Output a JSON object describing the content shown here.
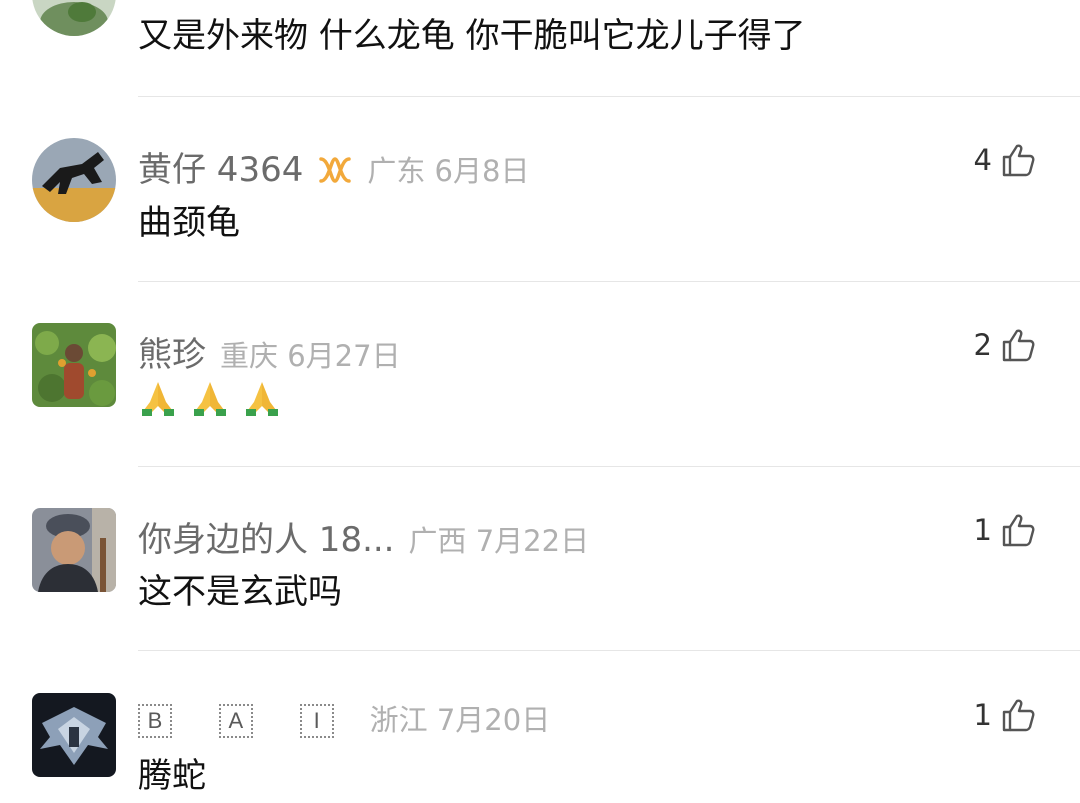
{
  "comments": [
    {
      "username": "",
      "location_date": "",
      "text": "又是外来物 什么龙龟 你干脆叫它龙儿子得了",
      "likes": ""
    },
    {
      "username": "黄仔 4364",
      "badge_icon": "gold-ring-badge-icon",
      "location_date": "广东 6月8日",
      "text": "曲颈龟",
      "likes": "4"
    },
    {
      "username": "熊珍",
      "location_date": "重庆 6月27日",
      "text": "",
      "emoji": [
        "folded-hands-emoji",
        "folded-hands-emoji",
        "folded-hands-emoji"
      ],
      "likes": "2"
    },
    {
      "username": "你身边的人 18...",
      "location_date": "广西 7月22日",
      "text": "这不是玄武吗",
      "likes": "1"
    },
    {
      "username_chars": [
        "B",
        "A",
        "I"
      ],
      "location_date": "浙江 7月20日",
      "text": "腾蛇",
      "likes": "1"
    }
  ],
  "colors": {
    "username": "#6b6b6b",
    "meta": "#b0b0b0",
    "text": "#111111",
    "divider": "#e6e6e6",
    "badge": "#f2a93b"
  }
}
